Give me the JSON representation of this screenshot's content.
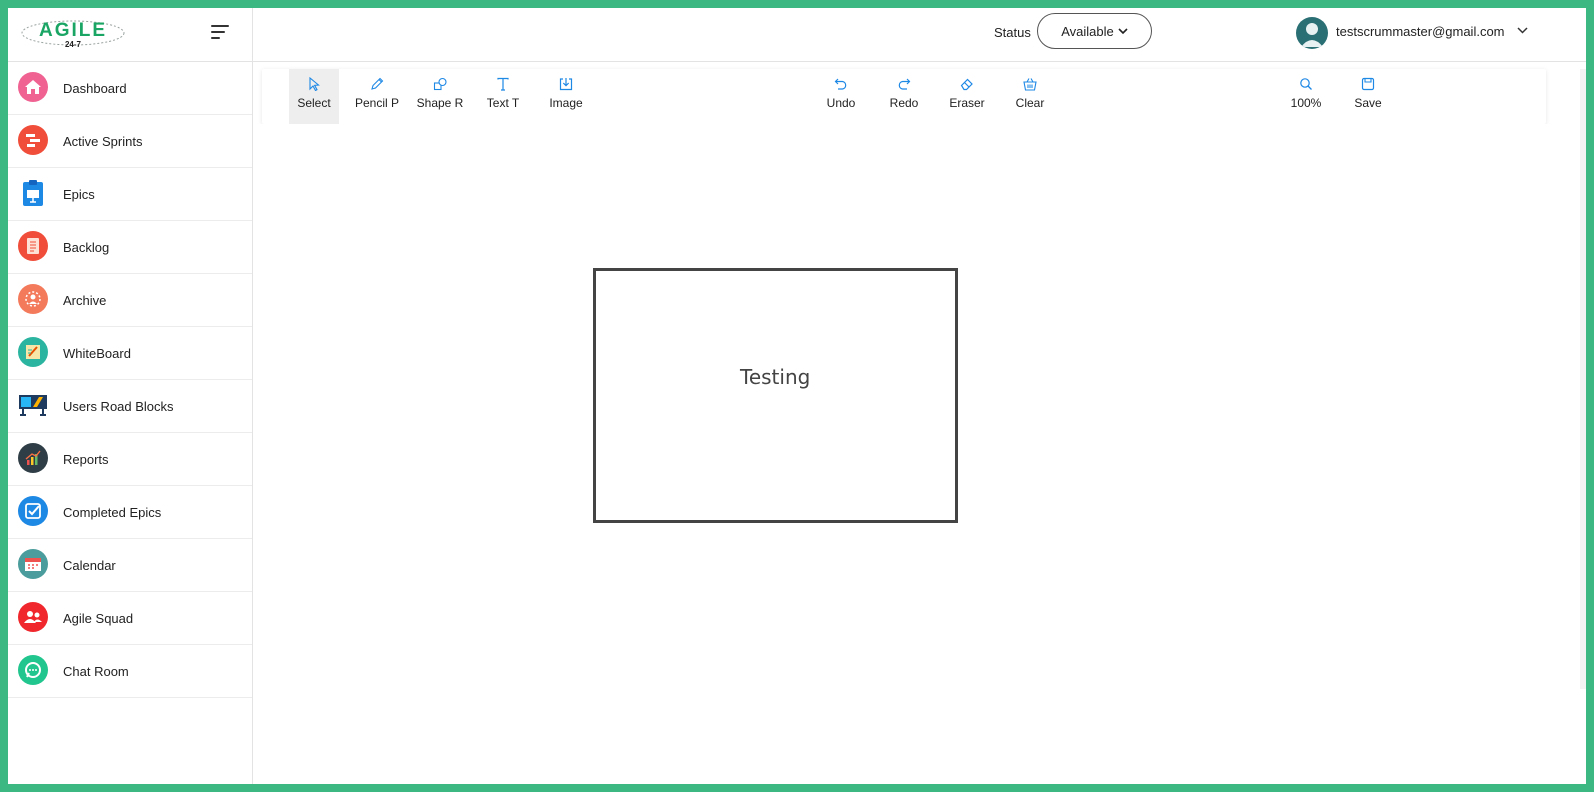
{
  "app": {
    "logo_main": "AGILE",
    "logo_sub": "24-7"
  },
  "sidebar": {
    "items": [
      {
        "label": "Dashboard",
        "icon": "home-icon",
        "color": "#f06292"
      },
      {
        "label": "Active Sprints",
        "icon": "sprints-icon",
        "color": "#f04e3a"
      },
      {
        "label": "Epics",
        "icon": "epics-icon",
        "color": "#1e88e5"
      },
      {
        "label": "Backlog",
        "icon": "backlog-icon",
        "color": "#f04e3a"
      },
      {
        "label": "Archive",
        "icon": "archive-icon",
        "color": "#f47a5c"
      },
      {
        "label": "WhiteBoard",
        "icon": "whiteboard-icon",
        "color": "#2bb5a0"
      },
      {
        "label": "Users Road Blocks",
        "icon": "roadblocks-icon",
        "color": "#1e88e5"
      },
      {
        "label": "Reports",
        "icon": "reports-icon",
        "color": "#2f3e46"
      },
      {
        "label": "Completed Epics",
        "icon": "completed-epics-icon",
        "color": "#1e88e5"
      },
      {
        "label": "Calendar",
        "icon": "calendar-icon",
        "color": "#4a9d9c"
      },
      {
        "label": "Agile Squad",
        "icon": "squad-icon",
        "color": "#f0282d"
      },
      {
        "label": "Chat Room",
        "icon": "chat-icon",
        "color": "#21c58e"
      }
    ]
  },
  "header": {
    "status_label": "Status",
    "status_value": "Available",
    "user_email": "testscrummaster@gmail.com"
  },
  "toolbar": {
    "select": "Select",
    "pencil": "Pencil P",
    "shape": "Shape R",
    "text": "Text T",
    "image": "Image",
    "undo": "Undo",
    "redo": "Redo",
    "eraser": "Eraser",
    "clear": "Clear",
    "zoom": "100%",
    "save": "Save",
    "accent_color": "#1e88e5"
  },
  "canvas": {
    "shape_text": "Testing"
  }
}
